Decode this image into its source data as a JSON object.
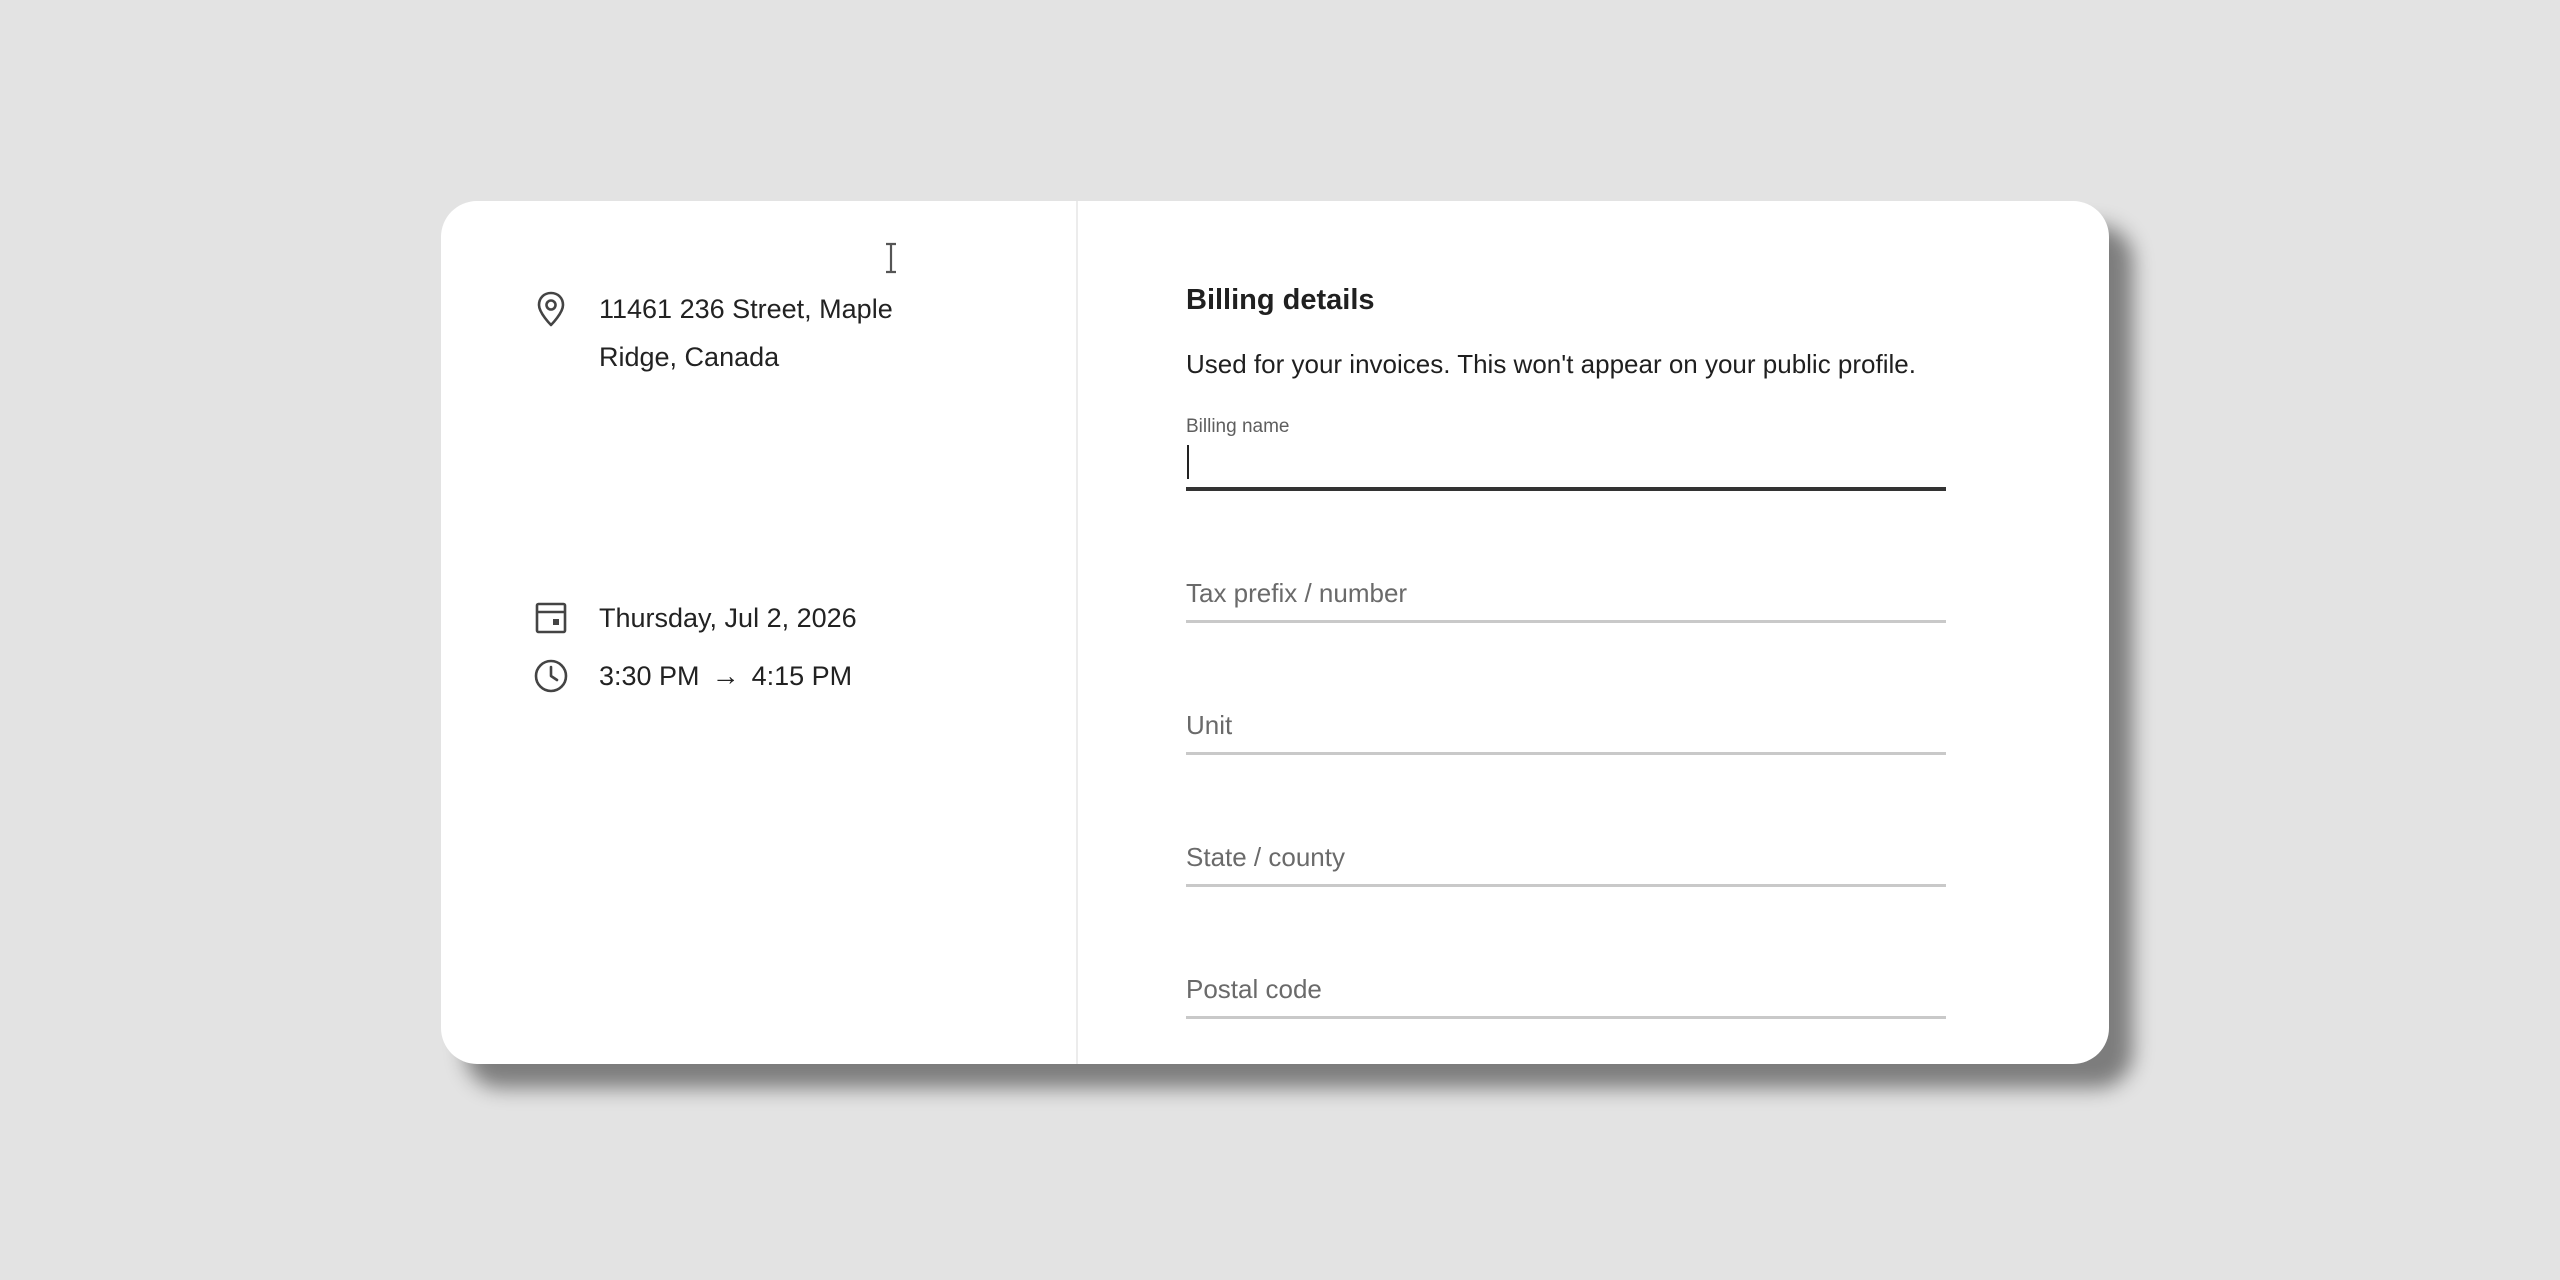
{
  "event": {
    "address": "11461 236 Street, Maple Ridge, Canada",
    "date": "Thursday, Jul 2, 2026",
    "time_start": "3:30 PM",
    "time_arrow": "→",
    "time_end": "4:15 PM",
    "icons": {
      "address": "location-pin-icon",
      "date": "calendar-icon",
      "time": "clock-icon"
    }
  },
  "billing": {
    "title": "Billing details",
    "description": "Used for your invoices. This won't appear on your public profile.",
    "fields": {
      "billing_name": {
        "label": "Billing name",
        "value": ""
      },
      "tax": {
        "placeholder": "Tax prefix / number",
        "value": ""
      },
      "unit": {
        "placeholder": "Unit",
        "value": ""
      },
      "state": {
        "placeholder": "State / county",
        "value": ""
      },
      "postal": {
        "placeholder": "Postal code",
        "value": ""
      }
    }
  },
  "colors": {
    "background": "#e3e3e3",
    "card": "#ffffff",
    "text": "#222222",
    "underline": "#c9c9c9",
    "underline_active": "#333333"
  }
}
